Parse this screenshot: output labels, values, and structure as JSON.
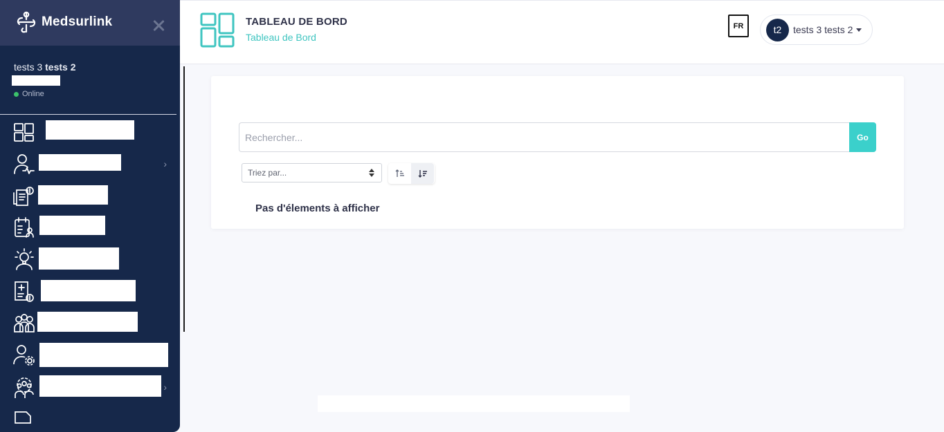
{
  "sidebar": {
    "brand": "Medsurlink",
    "user": {
      "first": "tests 3",
      "last": "tests 2",
      "status": "Online"
    },
    "items": [
      {
        "icon": "dashboard-grid-icon",
        "chevron": false
      },
      {
        "icon": "patient-heartbeat-icon",
        "chevron": true
      },
      {
        "icon": "invoice-icon",
        "chevron": false
      },
      {
        "icon": "appointment-calendar-icon",
        "chevron": false
      },
      {
        "icon": "idea-person-icon",
        "chevron": false
      },
      {
        "icon": "medical-billing-icon",
        "chevron": false
      },
      {
        "icon": "group-people-icon",
        "chevron": false
      },
      {
        "icon": "user-settings-icon",
        "chevron": false
      },
      {
        "icon": "team-settings-icon",
        "chevron": true
      }
    ]
  },
  "header": {
    "title": "TABLEAU DE BORD",
    "subtitle": "Tableau de Bord",
    "lang": "FR",
    "user_initials": "t2",
    "user_name": "tests 3 tests 2"
  },
  "main": {
    "search_placeholder": "Rechercher...",
    "go_label": "Go",
    "sort_placeholder": "Triez par...",
    "empty_message": "Pas d'élements à afficher"
  },
  "colors": {
    "sidebar_bg": "#16284a",
    "sidebar_header_bg": "#2f3a5f",
    "accent_teal": "#3bd0cb",
    "online": "#3cc26b"
  }
}
